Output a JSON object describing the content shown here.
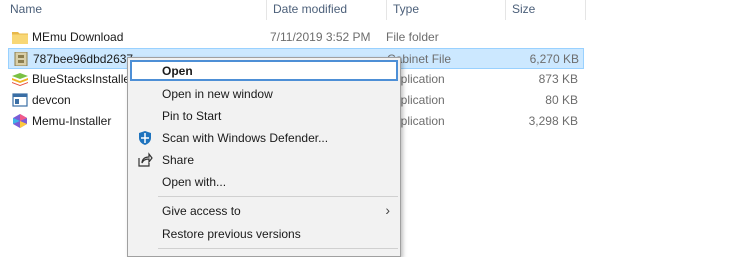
{
  "columns": {
    "name": "Name",
    "date": "Date modified",
    "type": "Type",
    "size": "Size"
  },
  "files": [
    {
      "name": "MEmu Download",
      "date": "7/11/2019 3:52 PM",
      "type": "File folder",
      "size": "",
      "icon": "folder-icon"
    },
    {
      "name": "787bee96dbd2637",
      "date": "",
      "type": "Cabinet File",
      "size": "6,270 KB",
      "icon": "cabinet-file-icon"
    },
    {
      "name": "BlueStacksInstalle",
      "date": "",
      "type": "Application",
      "size": "873 KB",
      "icon": "bluestacks-icon"
    },
    {
      "name": "devcon",
      "date": "",
      "type": "Application",
      "size": "80 KB",
      "icon": "application-icon"
    },
    {
      "name": "Memu-Installer",
      "date": "",
      "type": "Application",
      "size": "3,298 KB",
      "icon": "memu-icon"
    }
  ],
  "menu": {
    "open": "Open",
    "open_new_window": "Open in new window",
    "pin_start": "Pin to Start",
    "scan_defender": "Scan with Windows Defender...",
    "share": "Share",
    "open_with": "Open with...",
    "give_access": "Give access to",
    "restore_versions": "Restore previous versions"
  },
  "colors": {
    "selection": "#cce8ff",
    "menu_hover_border": "#4d8fd6",
    "menu_bg": "#f2f2f2"
  }
}
